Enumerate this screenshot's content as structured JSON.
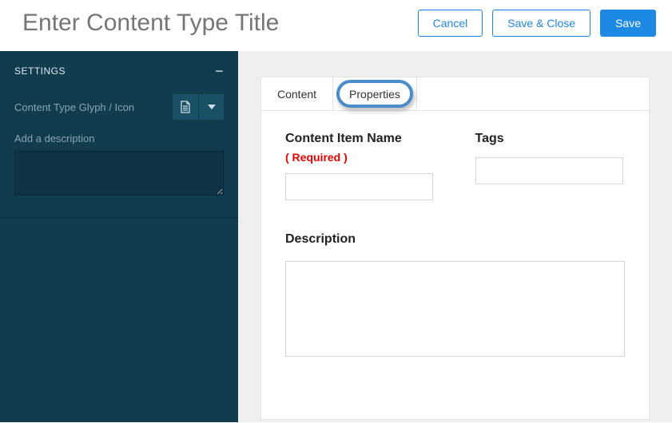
{
  "header": {
    "title_placeholder": "Enter Content Type Title",
    "cancel_label": "Cancel",
    "save_close_label": "Save & Close",
    "save_label": "Save"
  },
  "sidebar": {
    "section_label": "SETTINGS",
    "glyph_label": "Content Type Glyph / Icon",
    "description_label": "Add a description",
    "description_value": ""
  },
  "tabs": {
    "content_label": "Content",
    "properties_label": "Properties"
  },
  "form": {
    "content_item_name_label": "Content Item Name",
    "required_label": "( Required )",
    "content_item_name_value": "",
    "tags_label": "Tags",
    "tags_value": "",
    "description_label": "Description",
    "description_value": ""
  }
}
